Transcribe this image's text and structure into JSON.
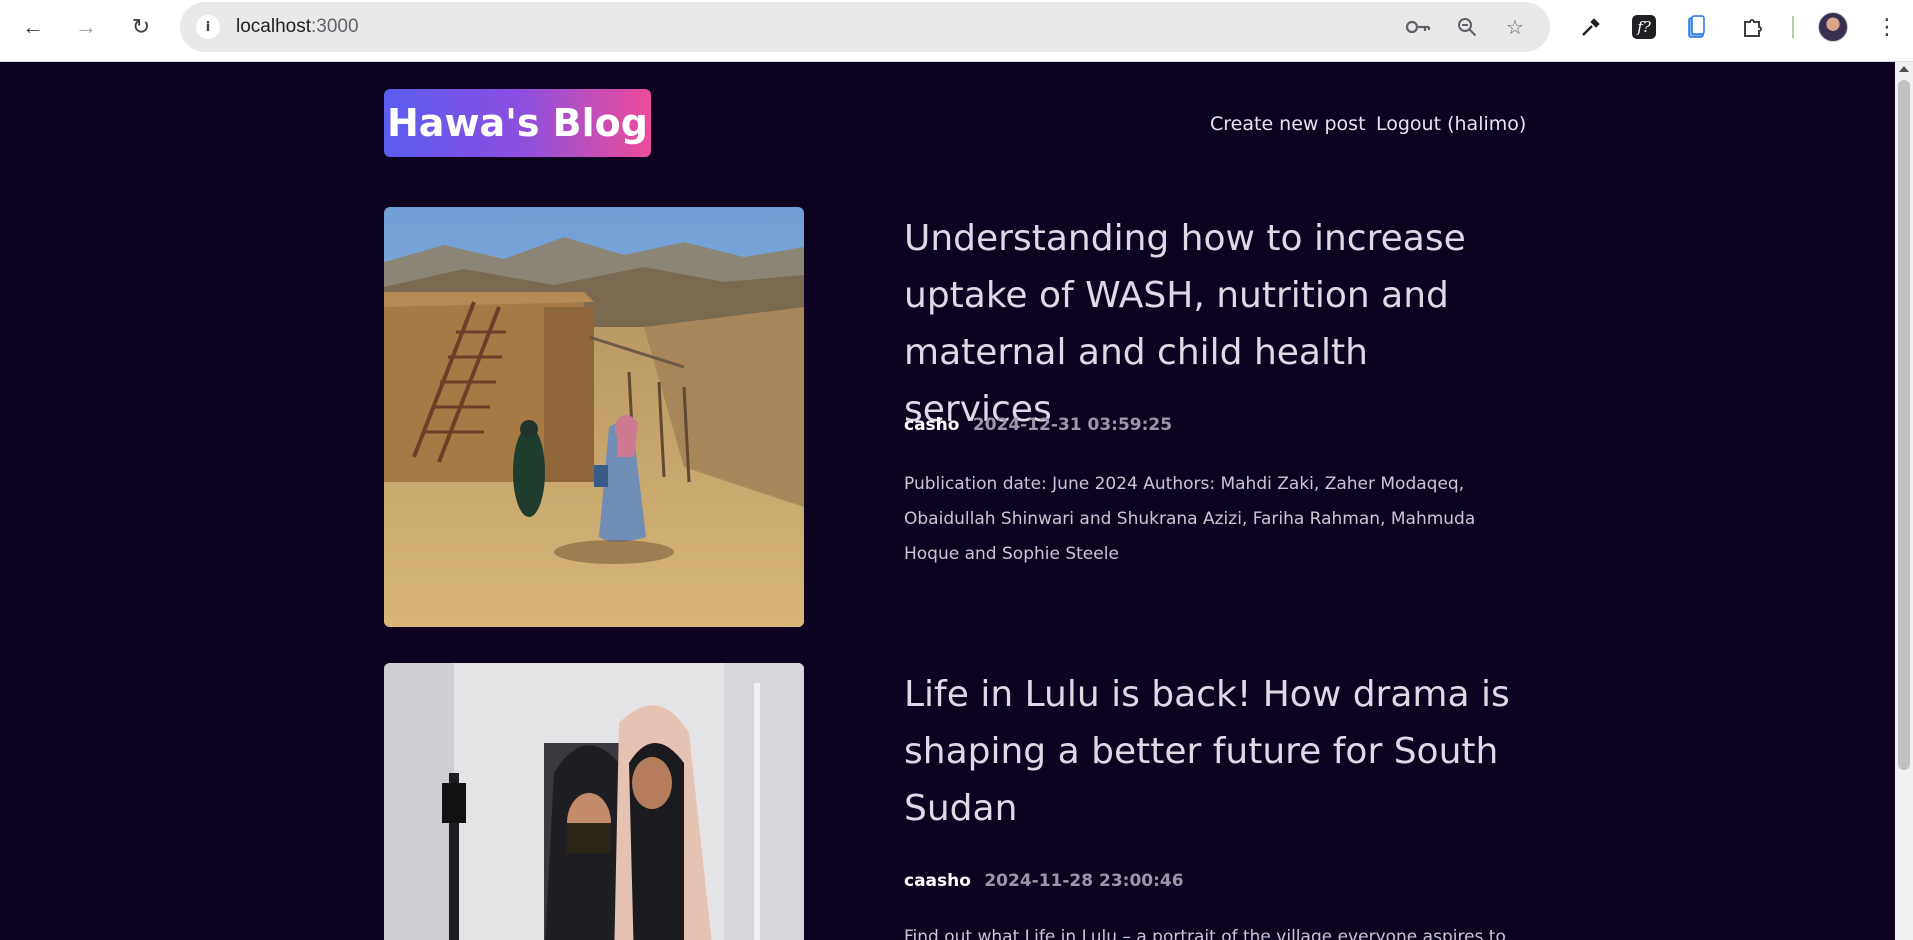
{
  "browser": {
    "url_host": "localhost",
    "url_port": ":3000"
  },
  "site": {
    "logo": "Hawa's Blog",
    "nav": {
      "create": "Create new post",
      "logout": "Logout (halimo)"
    }
  },
  "posts": [
    {
      "title": "Understanding how to increase uptake of WASH, nutrition and maternal and child health services",
      "author": "casho",
      "date": "2024-12-31 03:59:25",
      "summary": "Publication date: June 2024 Authors: Mahdi Zaki, Zaher Modaqeq, Obaidullah Shinwari and Shukrana Azizi, Fariha Rahman, Mahmuda Hoque and Sophie Steele"
    },
    {
      "title": "Life in Lulu is back! How drama is shaping a better future for South Sudan",
      "author": "caasho",
      "date": "2024-11-28 23:00:46",
      "summary": "Find out what Life in Lulu – a portrait of the village everyone aspires to"
    }
  ]
}
